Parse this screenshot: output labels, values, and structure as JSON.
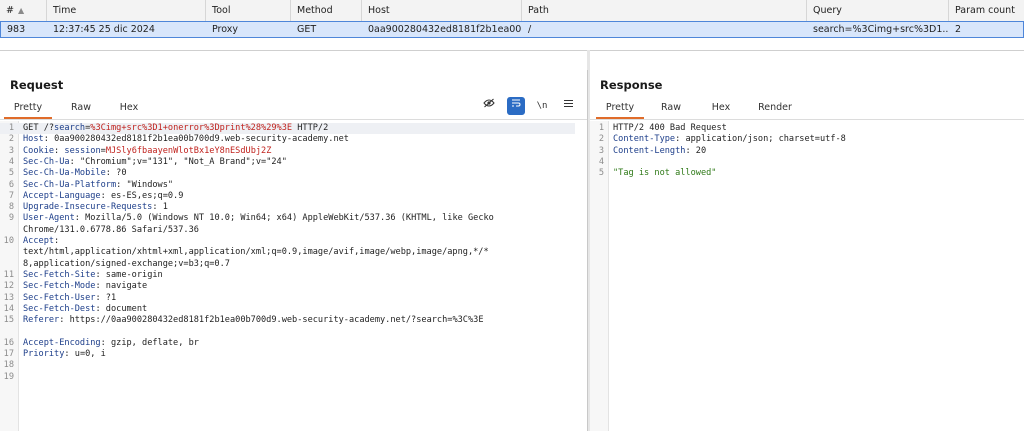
{
  "history": {
    "columns": [
      "#",
      "Time",
      "Tool",
      "Method",
      "Host",
      "Path",
      "Query",
      "Param count"
    ],
    "row": {
      "num": "983",
      "time": "12:37:45 25 dic 2024",
      "tool": "Proxy",
      "method": "GET",
      "host": "0aa900280432ed8181f2b1ea00...",
      "path": "/",
      "query": "search=%3Cimg+src%3D1...",
      "param_count": "2"
    }
  },
  "request": {
    "title": "Request",
    "tabs": [
      "Pretty",
      "Raw",
      "Hex"
    ],
    "active_tab": "Pretty",
    "icons": [
      "eye-slash-icon",
      "wrap-lines-icon",
      "newline-icon",
      "menu-icon"
    ],
    "lines": [
      {
        "n": "1",
        "pre": "GET /?",
        "param": "search",
        "eq": "=",
        "red": "%3Cimg+src%3D1+onerror%3Dprint%28%29%3E",
        "post": " HTTP/2",
        "highlight": true
      },
      {
        "n": "2",
        "name": "Host",
        "value": " 0aa900280432ed8181f2b1ea00b700d9.web-security-academy.net"
      },
      {
        "n": "3",
        "name": "Cookie",
        "value": " ",
        "cookie_name": "session",
        "cookie_eq": "=",
        "cookie_val": "MJSly6fbaayenWlotBx1eY8nESdUbj2Z"
      },
      {
        "n": "4",
        "name": "Sec-Ch-Ua",
        "value": " \"Chromium\";v=\"131\", \"Not_A Brand\";v=\"24\""
      },
      {
        "n": "5",
        "name": "Sec-Ch-Ua-Mobile",
        "value": " ?0"
      },
      {
        "n": "6",
        "name": "Sec-Ch-Ua-Platform",
        "value": " \"Windows\""
      },
      {
        "n": "7",
        "name": "Accept-Language",
        "value": " es-ES,es;q=0.9"
      },
      {
        "n": "8",
        "name": "Upgrade-Insecure-Requests",
        "value": " 1"
      },
      {
        "n": "9",
        "name": "User-Agent",
        "value": " Mozilla/5.0 (Windows NT 10.0; Win64; x64) AppleWebKit/537.36 (KHTML, like Gecko"
      },
      {
        "n": "",
        "text": "Chrome/131.0.6778.86 Safari/537.36"
      },
      {
        "n": "10",
        "name": "Accept",
        "value": ""
      },
      {
        "n": "",
        "text": "text/html,application/xhtml+xml,application/xml;q=0.9,image/avif,image/webp,image/apng,*/*"
      },
      {
        "n": "",
        "text": "8,application/signed-exchange;v=b3;q=0.7"
      },
      {
        "n": "11",
        "name": "Sec-Fetch-Site",
        "value": " same-origin"
      },
      {
        "n": "12",
        "name": "Sec-Fetch-Mode",
        "value": " navigate"
      },
      {
        "n": "13",
        "name": "Sec-Fetch-User",
        "value": " ?1"
      },
      {
        "n": "14",
        "name": "Sec-Fetch-Dest",
        "value": " document"
      },
      {
        "n": "15",
        "name": "Referer",
        "value": " https://0aa900280432ed8181f2b1ea00b700d9.web-security-academy.net/?search=%3C%3E"
      },
      {
        "n": "",
        "text": ""
      },
      {
        "n": "16",
        "name": "Accept-Encoding",
        "value": " gzip, deflate, br"
      },
      {
        "n": "17",
        "name": "Priority",
        "value": " u=0, i"
      },
      {
        "n": "18",
        "text": ""
      },
      {
        "n": "19",
        "text": ""
      }
    ]
  },
  "response": {
    "title": "Response",
    "tabs": [
      "Pretty",
      "Raw",
      "Hex",
      "Render"
    ],
    "active_tab": "Pretty",
    "lines": [
      {
        "n": "1",
        "text": "HTTP/2 400 Bad Request"
      },
      {
        "n": "2",
        "name": "Content-Type",
        "value": " application/json; charset=utf-8"
      },
      {
        "n": "3",
        "name": "Content-Length",
        "value": " 20"
      },
      {
        "n": "4",
        "text": ""
      },
      {
        "n": "5",
        "string": "\"Tag is not allowed\""
      }
    ]
  }
}
